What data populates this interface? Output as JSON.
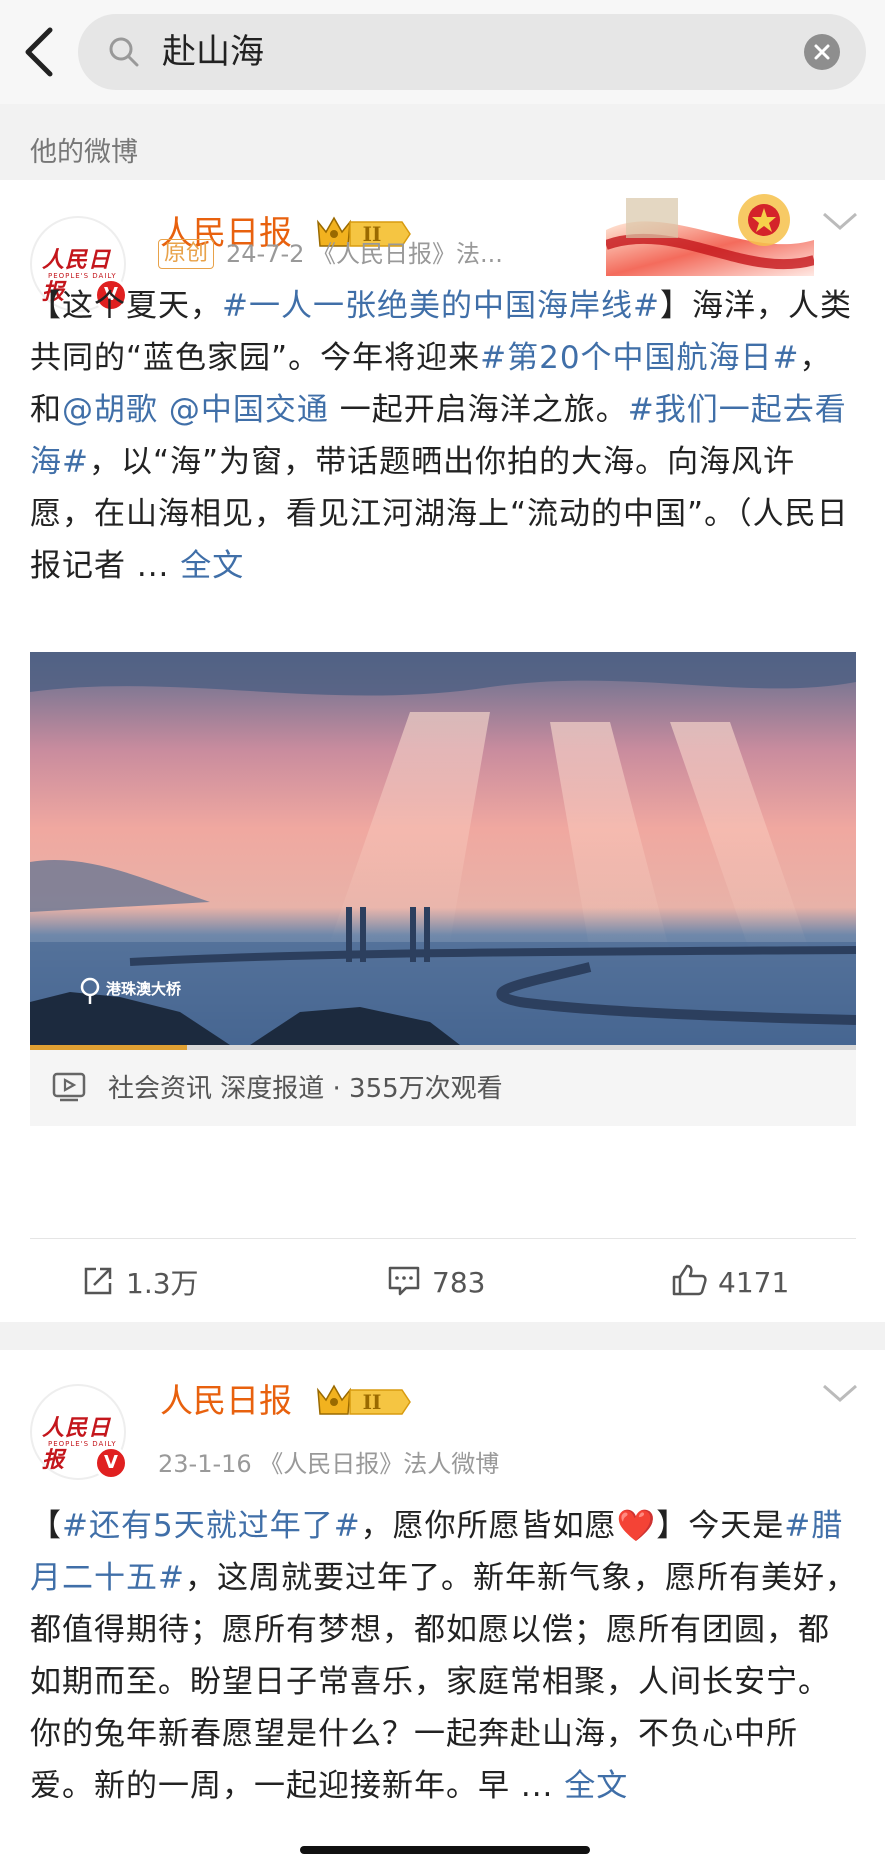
{
  "search": {
    "query": "赴山海"
  },
  "section": {
    "label": "他的微博"
  },
  "posts": [
    {
      "author": "人民日报",
      "level_badge": "II",
      "source_badge": "原创",
      "meta": "24-7-2 《人民日报》法...",
      "text_parts": [
        {
          "t": "【这个夏天，",
          "tag": false
        },
        {
          "t": "#一人一张绝美的中国海岸线#",
          "tag": true
        },
        {
          "t": "】海洋，人类共同的“蓝色家园”。今年将迎来",
          "tag": false
        },
        {
          "t": "#第20个中国航海日#",
          "tag": true
        },
        {
          "t": "，和",
          "tag": false
        },
        {
          "t": "@胡歌",
          "tag": true
        },
        {
          "t": " ",
          "tag": false
        },
        {
          "t": "@中国交通",
          "tag": true
        },
        {
          "t": " 一起开启海洋之旅。",
          "tag": false
        },
        {
          "t": "#我们一起去看海#",
          "tag": true
        },
        {
          "t": "，以“海”为窗，带话题晒出你拍的大海。向海风许愿，在山海相见，看见江河湖海上“流动的中国”。（人民日报记者 ... ",
          "tag": false
        },
        {
          "t": "全文",
          "tag": true
        }
      ],
      "image_location": "港珠澳大桥",
      "video_progress": 0.19,
      "video_info": "社会资讯 深度报道 · 355万次观看",
      "reposts": "1.3万",
      "comments": "783",
      "likes": "4171"
    },
    {
      "author": "人民日报",
      "level_badge": "II",
      "meta": "23-1-16 《人民日报》法人微博",
      "text_parts": [
        {
          "t": "【",
          "tag": false
        },
        {
          "t": "#还有5天就过年了#",
          "tag": true
        },
        {
          "t": "，愿你所愿皆如愿❤️】今天是",
          "tag": false
        },
        {
          "t": "#腊月二十五#",
          "tag": true
        },
        {
          "t": "，这周就要过年了。新年新气象，愿所有美好，都值得期待；愿所有梦想，都如愿以偿；愿所有团圆，都如期而至。盼望日子常喜乐，家庭常相聚，人间长安宁。你的兔年新春愿望是什么？一起奔赴山海，不负心中所爱。新的一周，一起迎接新年。早 ... ",
          "tag": false
        },
        {
          "t": "全文",
          "tag": true
        }
      ]
    }
  ],
  "avatar_logo": "人民日报",
  "avatar_sub": "PEOPLE'S DAILY",
  "colors": {
    "name": "#e8610e",
    "link": "#406fa8",
    "verified": "#e02020"
  }
}
